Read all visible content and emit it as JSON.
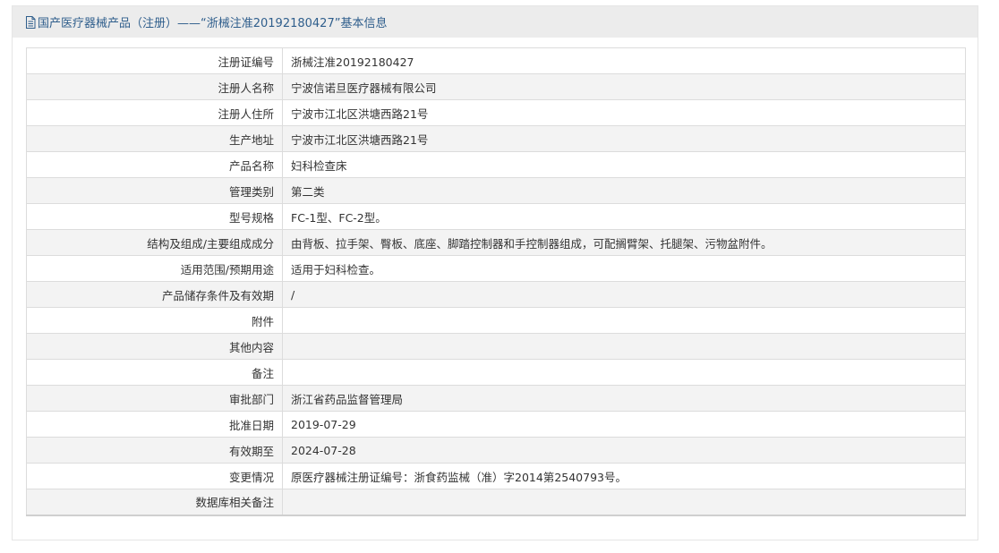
{
  "header": {
    "title": "国产医疗器械产品（注册）——“浙械注准20192180427”基本信息",
    "icon": "document-icon"
  },
  "rows": [
    {
      "label": "注册证编号",
      "value": "浙械注准20192180427"
    },
    {
      "label": "注册人名称",
      "value": "宁波信诺旦医疗器械有限公司"
    },
    {
      "label": "注册人住所",
      "value": "宁波市江北区洪塘西路21号"
    },
    {
      "label": "生产地址",
      "value": "宁波市江北区洪塘西路21号"
    },
    {
      "label": "产品名称",
      "value": "妇科检查床"
    },
    {
      "label": "管理类别",
      "value": "第二类"
    },
    {
      "label": "型号规格",
      "value": "FC-1型、FC-2型。"
    },
    {
      "label": "结构及组成/主要组成成分",
      "value": "由背板、拉手架、臀板、底座、脚踏控制器和手控制器组成，可配搁臂架、托腿架、污物盆附件。"
    },
    {
      "label": "适用范围/预期用途",
      "value": "适用于妇科检查。"
    },
    {
      "label": "产品储存条件及有效期",
      "value": "/"
    },
    {
      "label": "附件",
      "value": ""
    },
    {
      "label": "其他内容",
      "value": ""
    },
    {
      "label": "备注",
      "value": ""
    },
    {
      "label": "审批部门",
      "value": "浙江省药品监督管理局"
    },
    {
      "label": "批准日期",
      "value": "2019-07-29"
    },
    {
      "label": "有效期至",
      "value": "2024-07-28"
    },
    {
      "label": "变更情况",
      "value": "原医疗器械注册证编号：浙食药监械（准）字2014第2540793号。"
    },
    {
      "label": "数据库相关备注",
      "value": ""
    }
  ]
}
